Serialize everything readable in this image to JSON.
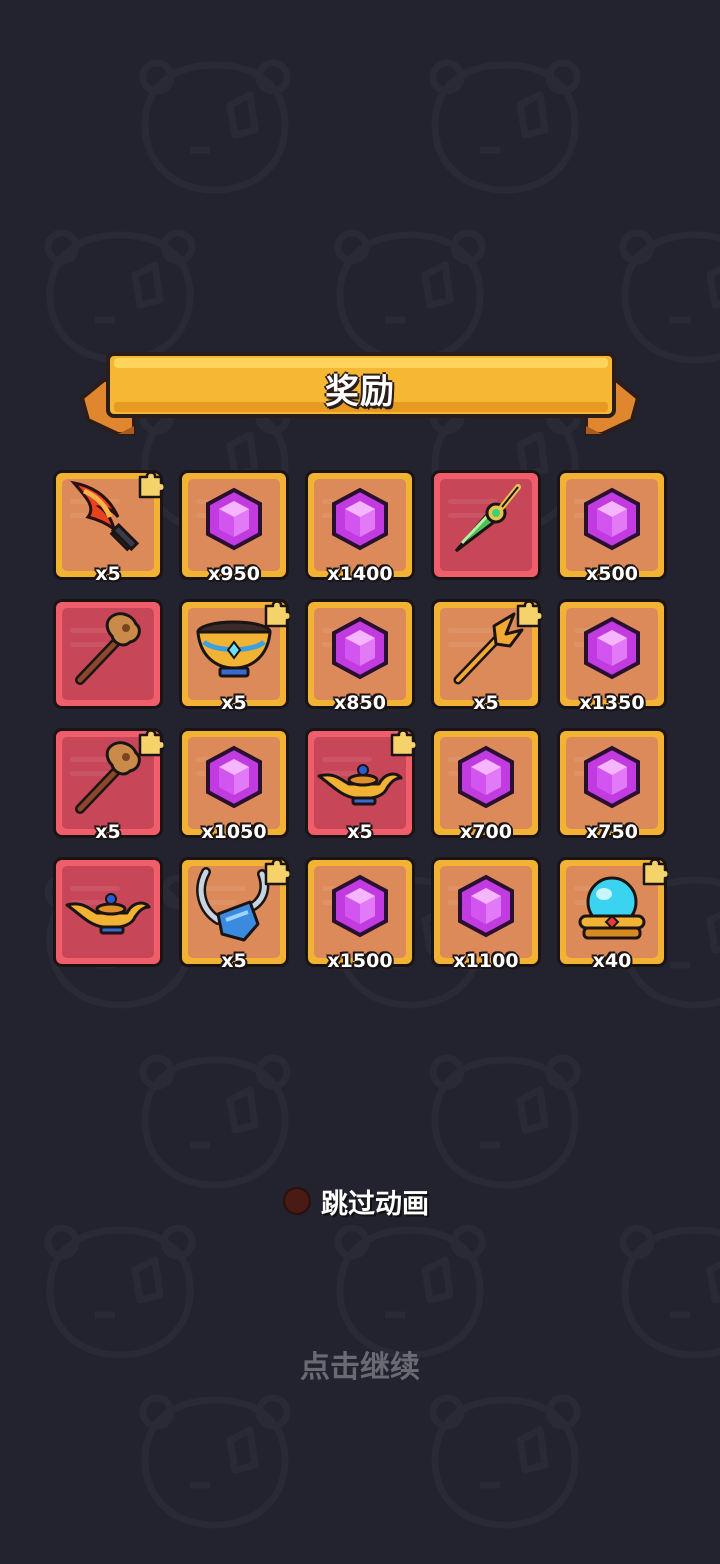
{
  "banner": {
    "title": "奖励"
  },
  "colors": {
    "background": "#23232f",
    "tile_gold": "#f2b233",
    "tile_red": "#f05d6b",
    "gem": "#c23be0",
    "text": "#ffffff"
  },
  "rewards": [
    {
      "icon": "flame-sword-icon",
      "rarity": "gold",
      "qty": "x5",
      "shard": true
    },
    {
      "icon": "purple-gem-icon",
      "rarity": "gold",
      "qty": "x950",
      "shard": false
    },
    {
      "icon": "purple-gem-icon",
      "rarity": "gold",
      "qty": "x1400",
      "shard": false
    },
    {
      "icon": "jade-dagger-icon",
      "rarity": "red",
      "qty": "",
      "shard": false
    },
    {
      "icon": "purple-gem-icon",
      "rarity": "gold",
      "qty": "x500",
      "shard": false
    },
    {
      "icon": "wooden-staff-icon",
      "rarity": "red",
      "qty": "",
      "shard": false
    },
    {
      "icon": "golden-bowl-icon",
      "rarity": "gold",
      "qty": "x5",
      "shard": true
    },
    {
      "icon": "purple-gem-icon",
      "rarity": "gold",
      "qty": "x850",
      "shard": false
    },
    {
      "icon": "trident-icon",
      "rarity": "gold",
      "qty": "x5",
      "shard": true
    },
    {
      "icon": "purple-gem-icon",
      "rarity": "gold",
      "qty": "x1350",
      "shard": false
    },
    {
      "icon": "wooden-staff-icon",
      "rarity": "red",
      "qty": "x5",
      "shard": true
    },
    {
      "icon": "purple-gem-icon",
      "rarity": "gold",
      "qty": "x1050",
      "shard": false
    },
    {
      "icon": "magic-lamp-icon",
      "rarity": "red",
      "qty": "x5",
      "shard": true
    },
    {
      "icon": "purple-gem-icon",
      "rarity": "gold",
      "qty": "x700",
      "shard": false
    },
    {
      "icon": "purple-gem-icon",
      "rarity": "gold",
      "qty": "x750",
      "shard": false
    },
    {
      "icon": "magic-lamp-icon",
      "rarity": "red",
      "qty": "",
      "shard": false
    },
    {
      "icon": "horned-helmet-icon",
      "rarity": "gold",
      "qty": "x5",
      "shard": true
    },
    {
      "icon": "purple-gem-icon",
      "rarity": "gold",
      "qty": "x1500",
      "shard": false
    },
    {
      "icon": "purple-gem-icon",
      "rarity": "gold",
      "qty": "x1100",
      "shard": false
    },
    {
      "icon": "crystal-orb-icon",
      "rarity": "gold",
      "qty": "x40",
      "shard": true
    }
  ],
  "skip_animation": {
    "label": "跳过动画",
    "checked": false
  },
  "continue_hint": "点击继续"
}
